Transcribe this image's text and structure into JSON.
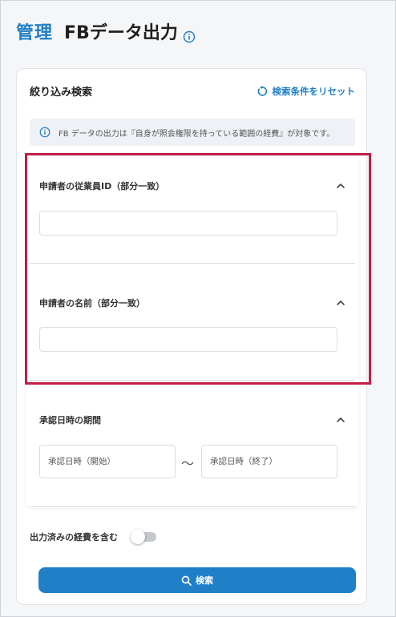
{
  "header": {
    "breadcrumb": "管理",
    "title": "FBデータ出力"
  },
  "filter_panel": {
    "title": "絞り込み検索",
    "reset_label": "検索条件をリセット",
    "notice": "FB データの出力は『自身が照会権限を持っている範囲の経費』が対象です。"
  },
  "sections": {
    "employee_id": {
      "label": "申請者の従業員ID（部分一致）",
      "value": ""
    },
    "applicant_name": {
      "label": "申請者の名前（部分一致）",
      "value": ""
    },
    "approval_period": {
      "label": "承認日時の期間",
      "start_placeholder": "承認日時（開始）",
      "separator": "〜",
      "end_placeholder": "承認日時（終了）"
    }
  },
  "toggle": {
    "label": "出力済みの経費を含む",
    "checked": false
  },
  "search_button": {
    "label": "検索"
  },
  "colors": {
    "accent": "#1f80c8",
    "highlight": "#c21d43"
  }
}
